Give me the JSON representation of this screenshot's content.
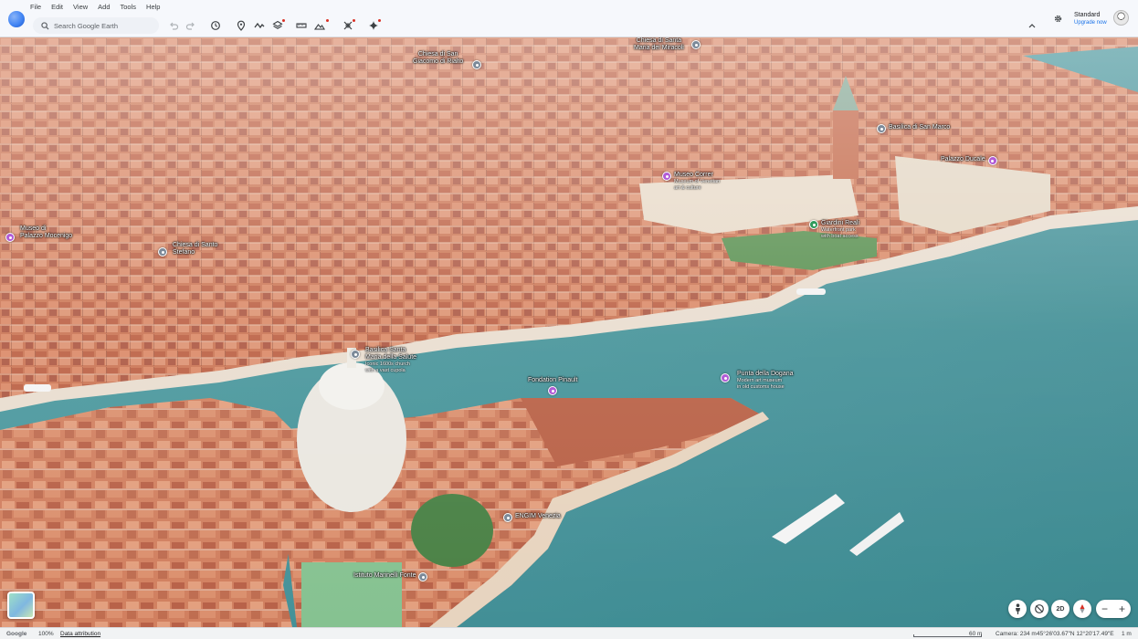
{
  "menu": [
    "File",
    "Edit",
    "View",
    "Add",
    "Tools",
    "Help"
  ],
  "search": {
    "placeholder": "Search Google Earth"
  },
  "toolbar": {
    "icons": [
      "undo-icon",
      "redo-icon",
      "history-icon",
      "placemark-icon",
      "path-icon",
      "layers-icon",
      "ruler-icon",
      "map-style-icon",
      "projects-icon",
      "gemini-sparkle-icon"
    ]
  },
  "account": {
    "plan": "Standard",
    "upgrade": "Upgrade now"
  },
  "places": [
    {
      "name": "Chiesa di San Giacomo di Rialto",
      "lines": [
        "Chiesa di San",
        "Giacomo di Rialto"
      ],
      "desc": [],
      "color": "grey"
    },
    {
      "name": "Chiesa di Santa Maria dei Miracoli",
      "lines": [
        "Chiesa di Santa",
        "Maria dei Miracoli"
      ],
      "desc": [],
      "color": "grey"
    },
    {
      "name": "Basilica di San Marco",
      "lines": [
        "Basilica di San Marco"
      ],
      "desc": [],
      "color": "grey"
    },
    {
      "name": "Palazzo Ducale",
      "lines": [
        "Palazzo Ducale"
      ],
      "desc": [],
      "color": "purple"
    },
    {
      "name": "Museo Correr",
      "lines": [
        "Museo Correr"
      ],
      "desc": [
        "Museum of Venetian",
        "art & culture"
      ],
      "color": "purple"
    },
    {
      "name": "Giardini Reali",
      "lines": [
        "Giardini Reali"
      ],
      "desc": [
        "Waterfront park",
        "with boat access"
      ],
      "color": "green"
    },
    {
      "name": "Museo di Palazzo Mocenigo",
      "lines": [
        "Museo di",
        "Palazzo Mocenigo"
      ],
      "desc": [],
      "color": "purple"
    },
    {
      "name": "Chiesa di Santo Stefano",
      "lines": [
        "Chiesa di Santo",
        "Stefano"
      ],
      "desc": [],
      "color": "grey"
    },
    {
      "name": "Basilica Santa Maria della Salute",
      "lines": [
        "Basilica Santa",
        "Maria della Salute"
      ],
      "desc": [
        "Iconic 1600s church",
        "with a vast cupola"
      ],
      "color": "grey"
    },
    {
      "name": "Fondation Pinault",
      "lines": [
        "Fondation Pinault"
      ],
      "desc": [],
      "color": "purple"
    },
    {
      "name": "Punta della Dogana",
      "lines": [
        "Punta della Dogana"
      ],
      "desc": [
        "Modern art museum",
        "in old customs house"
      ],
      "color": "purple"
    },
    {
      "name": "ENGIM Venezia",
      "lines": [
        "ENGIM Venezia"
      ],
      "desc": [],
      "color": "grey"
    },
    {
      "name": "Istituto Marinelli Fonte",
      "lines": [
        "Istituto Marinelli Fonte"
      ],
      "desc": [],
      "color": "grey"
    }
  ],
  "map_controls": {
    "view_2d": "2D",
    "zoom_out": "−",
    "zoom_in": "+"
  },
  "status": {
    "brand": "Google",
    "zoom": "100%",
    "attribution": "Data attribution",
    "scale": "60 m",
    "camera": "Camera: 234 m",
    "coordinates": "45°26'03.67\"N 12°20'17.49\"E",
    "elevation": "1 m"
  },
  "colors": {
    "water": "#3d8f95",
    "roofs": "#c86a46",
    "accent": "#1a73e8"
  }
}
